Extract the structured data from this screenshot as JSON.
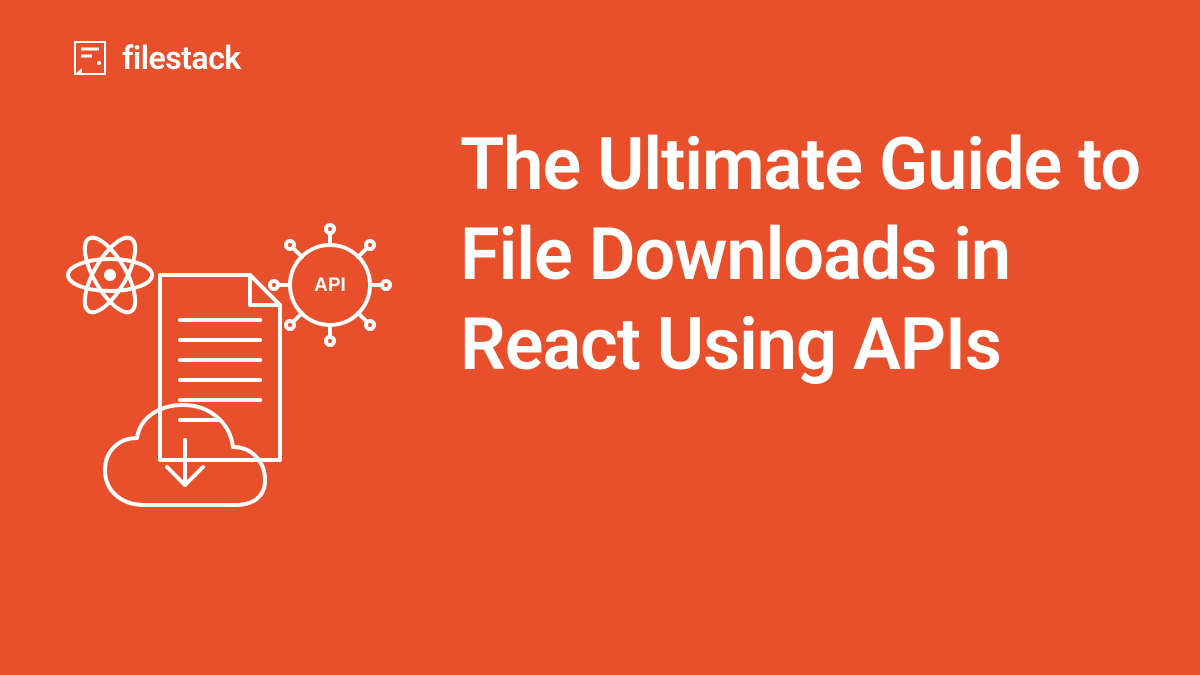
{
  "brand": {
    "name": "filestack"
  },
  "title": "The Ultimate Guide to File Downloads in React Using APIs",
  "illustration": {
    "api_label": "API"
  },
  "colors": {
    "background": "#E8502B",
    "foreground": "#FFFFFF"
  }
}
